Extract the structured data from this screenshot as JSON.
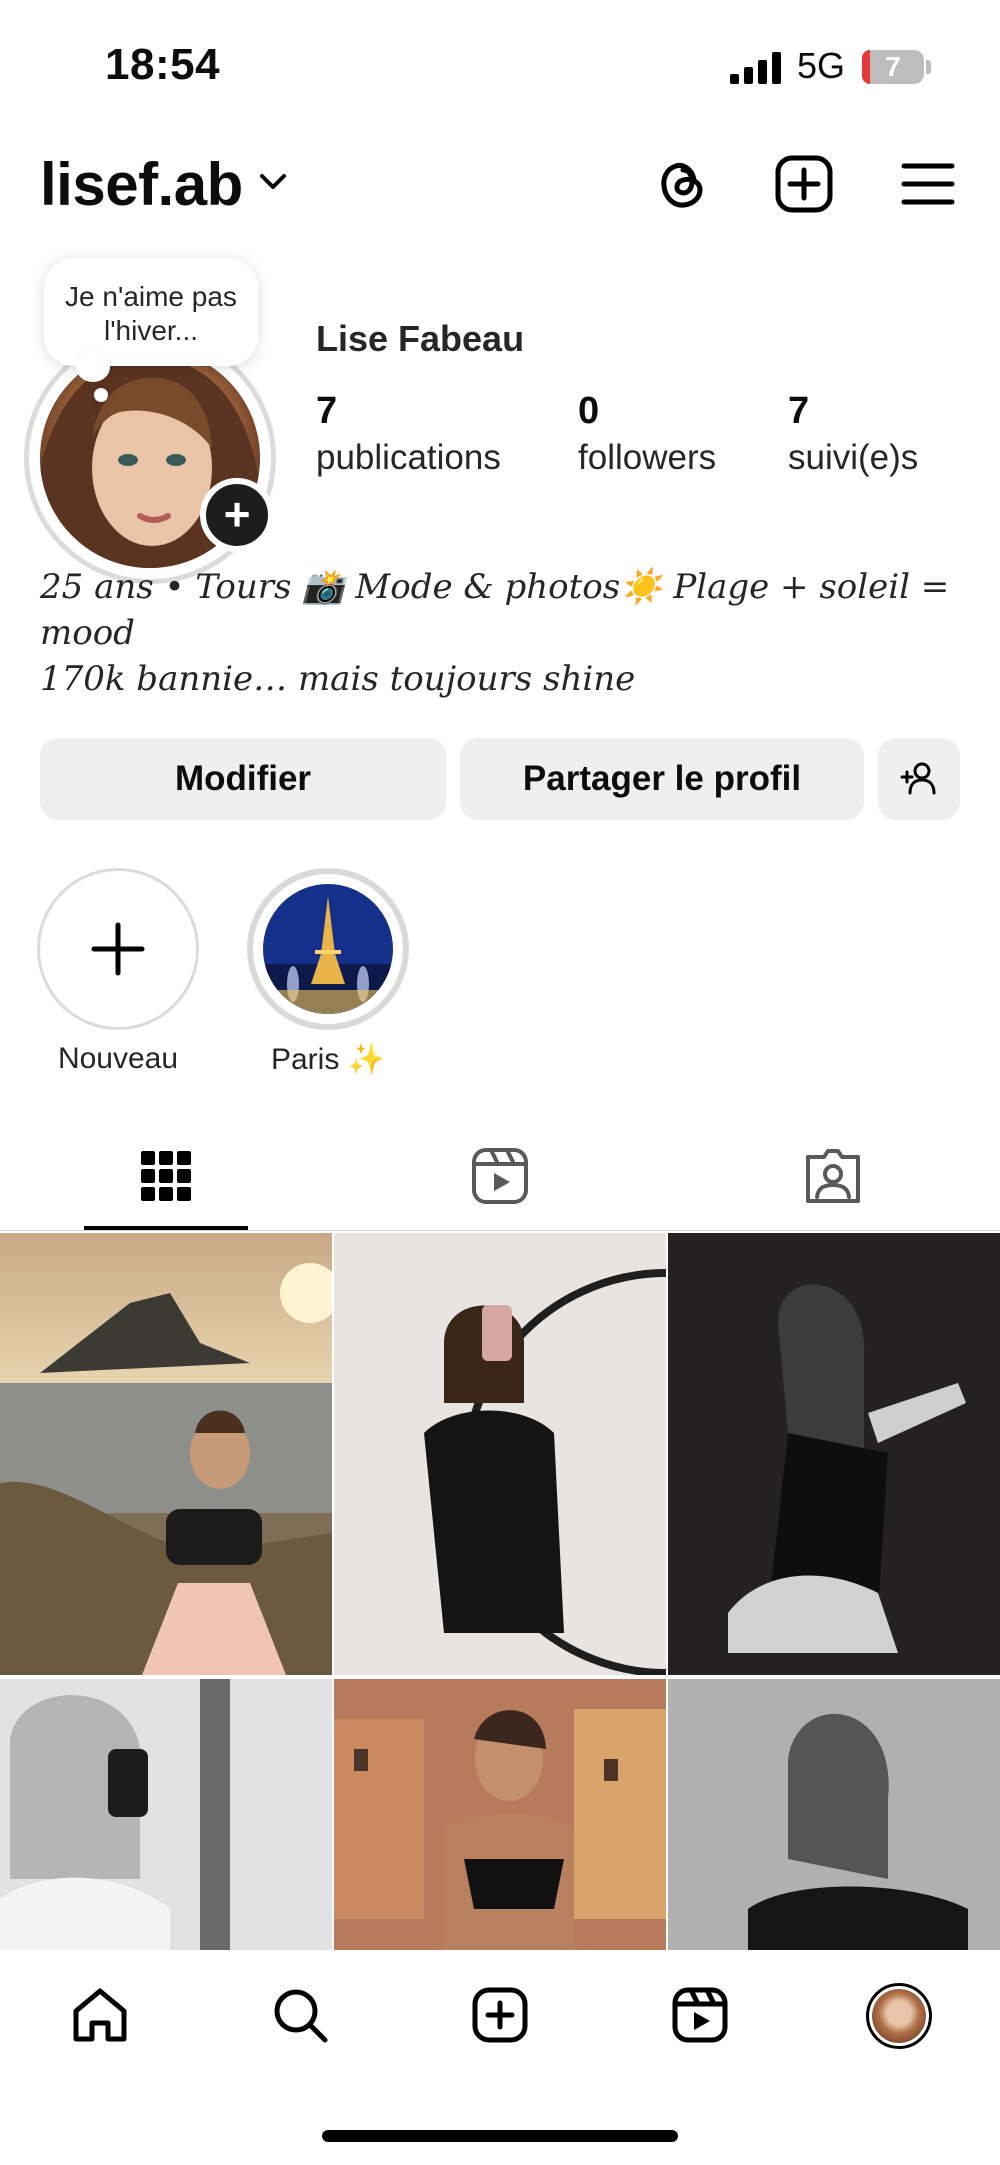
{
  "status_bar": {
    "time": "18:54",
    "network": "5G",
    "battery": "7"
  },
  "header": {
    "username": "lisef.ab",
    "icons": [
      "threads-icon",
      "create-icon",
      "menu-icon"
    ]
  },
  "profile": {
    "note": "Je n'aime pas l'hiver...",
    "full_name": "Lise Fabeau",
    "stats": [
      {
        "value": "7",
        "label": "publications"
      },
      {
        "value": "0",
        "label": "followers"
      },
      {
        "value": "7",
        "label": "suivi(e)s"
      }
    ],
    "bio_line1": "25 ans • Tours 📸 Mode & photos☀️ Plage + soleil = mood",
    "bio_line2": "170k bannie… mais toujours shine"
  },
  "buttons": {
    "edit": "Modifier",
    "share": "Partager le profil"
  },
  "highlights": [
    {
      "label": "Nouveau"
    },
    {
      "label": "Paris ✨"
    }
  ],
  "tabs": [
    "grid-icon",
    "reels-icon",
    "tagged-icon"
  ],
  "bottom_nav": [
    "home-icon",
    "search-icon",
    "create-icon",
    "reels-icon",
    "profile-avatar"
  ],
  "colors": {
    "button_bg": "#efefef",
    "text": "#0c0c0c",
    "separator": "#dbdbdb",
    "battery_low": "#e53935"
  }
}
